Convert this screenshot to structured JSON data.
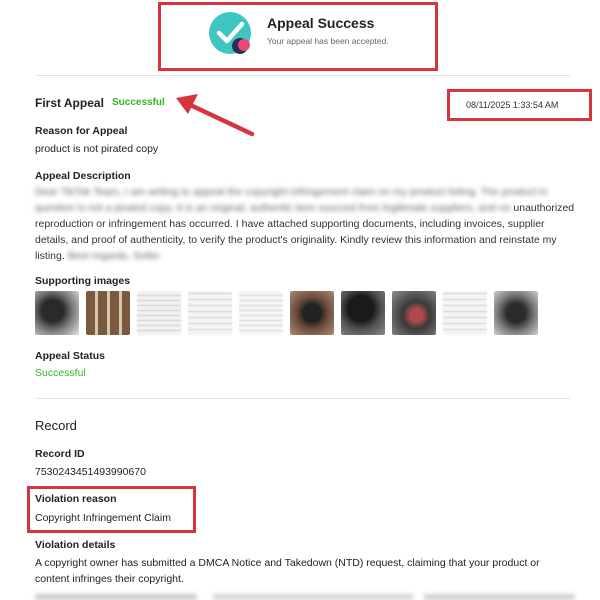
{
  "success_card": {
    "title": "Appeal Success",
    "subtitle": "Your appeal has been accepted.",
    "icon": "check-circle-icon",
    "colors": {
      "teal": "#3ec6c2",
      "navy": "#2b2d5c",
      "pink": "#e84a78"
    }
  },
  "appeal": {
    "title": "First Appeal",
    "status_badge": "Successful",
    "date": "08/11/2025 1:33:54 AM",
    "reason_label": "Reason for Appeal",
    "reason_value": "product is not pirated copy",
    "description_label": "Appeal Description",
    "description_visible": "unauthorized reproduction or infringement has occurred. I have attached supporting documents, including invoices, supplier details, and proof of authenticity, to verify the product's originality. Kindly review this information and reinstate my listing.",
    "images_label": "Supporting images",
    "status_label": "Appeal Status",
    "status_value": "Successful"
  },
  "record": {
    "title": "Record",
    "id_label": "Record ID",
    "id_value": "7530243451493990670",
    "violation_reason_label": "Violation reason",
    "violation_reason_value": "Copyright Infringement Claim",
    "violation_details_label": "Violation details",
    "violation_details_value": "A copyright owner has submitted a DMCA Notice and Takedown (NTD) request, claiming that your product or content infringes their copyright."
  },
  "colors": {
    "highlight_red": "#d8343e",
    "success_green": "#3cb02a"
  }
}
